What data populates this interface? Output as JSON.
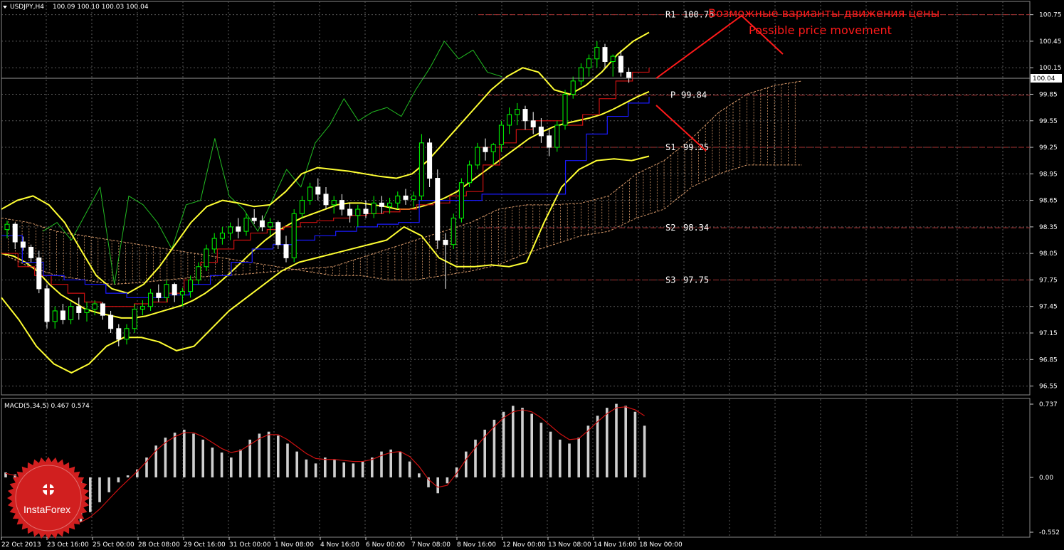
{
  "header": {
    "symbol": "USDJPY,H4",
    "ohlc": "100.09 100.10 100.03 100.04"
  },
  "macd": {
    "label": "MACD(5,34,5) 0.467 0.574"
  },
  "colors": {
    "bull": "#00ff00",
    "bear": "#ffffff",
    "bollinger": "#ffff33",
    "tenkan": "#cc1111",
    "kijun": "#1a1aff",
    "chikou": "#22bb22",
    "cloud": "#d89a6a",
    "pivot_line": "#aa3333",
    "annotation": "#ff1a1a",
    "grid": "#5a5a5a"
  },
  "chart_data": {
    "type": "candlestick",
    "symbol": "USDJPY",
    "timeframe": "H4",
    "current_price": "100.04",
    "ylim": [
      96.45,
      100.9
    ],
    "y_ticks": [
      "100.75",
      "100.45",
      "100.15",
      "99.85",
      "99.55",
      "99.25",
      "98.95",
      "98.65",
      "98.35",
      "98.05",
      "97.75",
      "97.45",
      "97.15",
      "96.85",
      "96.55"
    ],
    "x_ticks": [
      "22 Oct 2013",
      "23 Oct 16:00",
      "25 Oct 00:00",
      "28 Oct 08:00",
      "29 Oct 16:00",
      "31 Oct 00:00",
      "1 Nov 08:00",
      "4 Nov 16:00",
      "6 Nov 00:00",
      "7 Nov 08:00",
      "8 Nov 16:00",
      "12 Nov 00:00",
      "13 Nov 08:00",
      "14 Nov 16:00",
      "18 Nov 00:00"
    ],
    "pivots": [
      {
        "label": "R1",
        "value": 100.75
      },
      {
        "label": "P",
        "value": 99.84
      },
      {
        "label": "S1",
        "value": 99.25
      },
      {
        "label": "S2",
        "value": 98.34
      },
      {
        "label": "S3",
        "value": 97.75
      }
    ],
    "candles": [
      [
        98.32,
        98.42,
        98.22,
        98.38
      ],
      [
        98.38,
        98.4,
        98.1,
        98.18
      ],
      [
        98.18,
        98.24,
        98.08,
        98.12
      ],
      [
        98.12,
        98.15,
        97.95,
        98.0
      ],
      [
        98.0,
        98.08,
        97.6,
        97.65
      ],
      [
        97.65,
        97.7,
        97.2,
        97.28
      ],
      [
        97.28,
        97.45,
        97.2,
        97.4
      ],
      [
        97.4,
        97.48,
        97.25,
        97.3
      ],
      [
        97.3,
        97.5,
        97.25,
        97.45
      ],
      [
        97.45,
        97.55,
        97.3,
        97.38
      ],
      [
        97.38,
        97.5,
        97.28,
        97.42
      ],
      [
        97.42,
        97.52,
        97.35,
        97.48
      ],
      [
        97.48,
        97.5,
        97.3,
        97.35
      ],
      [
        97.35,
        97.4,
        97.15,
        97.2
      ],
      [
        97.2,
        97.25,
        97.0,
        97.08
      ],
      [
        97.08,
        97.25,
        97.02,
        97.2
      ],
      [
        97.2,
        97.48,
        97.15,
        97.42
      ],
      [
        97.42,
        97.52,
        97.35,
        97.45
      ],
      [
        97.45,
        97.65,
        97.4,
        97.6
      ],
      [
        97.6,
        97.7,
        97.5,
        97.55
      ],
      [
        97.55,
        97.75,
        97.5,
        97.7
      ],
      [
        97.7,
        97.72,
        97.5,
        97.58
      ],
      [
        97.58,
        97.66,
        97.45,
        97.62
      ],
      [
        97.62,
        97.8,
        97.55,
        97.75
      ],
      [
        97.75,
        97.95,
        97.7,
        97.9
      ],
      [
        97.9,
        98.15,
        97.85,
        98.1
      ],
      [
        98.1,
        98.28,
        98.05,
        98.22
      ],
      [
        98.22,
        98.35,
        98.15,
        98.28
      ],
      [
        98.28,
        98.4,
        98.2,
        98.35
      ],
      [
        98.35,
        98.45,
        98.22,
        98.3
      ],
      [
        98.3,
        98.5,
        98.25,
        98.45
      ],
      [
        98.45,
        98.55,
        98.38,
        98.42
      ],
      [
        98.42,
        98.48,
        98.3,
        98.35
      ],
      [
        98.35,
        98.45,
        98.25,
        98.4
      ],
      [
        98.4,
        98.42,
        98.1,
        98.15
      ],
      [
        98.15,
        98.25,
        97.95,
        98.0
      ],
      [
        98.0,
        98.55,
        97.95,
        98.5
      ],
      [
        98.5,
        98.7,
        98.45,
        98.65
      ],
      [
        98.65,
        98.85,
        98.6,
        98.8
      ],
      [
        98.8,
        98.9,
        98.65,
        98.72
      ],
      [
        98.72,
        98.8,
        98.55,
        98.6
      ],
      [
        98.6,
        98.7,
        98.5,
        98.65
      ],
      [
        98.65,
        98.72,
        98.48,
        98.55
      ],
      [
        98.55,
        98.62,
        98.4,
        98.48
      ],
      [
        98.48,
        98.6,
        98.35,
        98.55
      ],
      [
        98.55,
        98.65,
        98.45,
        98.5
      ],
      [
        98.5,
        98.7,
        98.45,
        98.62
      ],
      [
        98.62,
        98.7,
        98.5,
        98.58
      ],
      [
        98.58,
        98.68,
        98.5,
        98.62
      ],
      [
        98.62,
        98.75,
        98.55,
        98.7
      ],
      [
        98.7,
        98.78,
        98.6,
        98.66
      ],
      [
        98.66,
        98.75,
        98.58,
        98.7
      ],
      [
        98.7,
        99.4,
        98.65,
        99.3
      ],
      [
        99.3,
        99.35,
        98.8,
        98.9
      ],
      [
        98.9,
        99.0,
        98.1,
        98.2
      ],
      [
        98.2,
        98.28,
        97.65,
        98.15
      ],
      [
        98.15,
        98.5,
        98.1,
        98.45
      ],
      [
        98.45,
        98.9,
        98.4,
        98.85
      ],
      [
        98.85,
        99.1,
        98.8,
        99.05
      ],
      [
        99.05,
        99.3,
        99.0,
        99.25
      ],
      [
        99.25,
        99.35,
        99.1,
        99.2
      ],
      [
        99.2,
        99.3,
        99.05,
        99.28
      ],
      [
        99.28,
        99.55,
        99.2,
        99.5
      ],
      [
        99.5,
        99.7,
        99.4,
        99.62
      ],
      [
        99.62,
        99.75,
        99.5,
        99.68
      ],
      [
        99.68,
        99.72,
        99.45,
        99.55
      ],
      [
        99.55,
        99.65,
        99.4,
        99.48
      ],
      [
        99.48,
        99.58,
        99.3,
        99.38
      ],
      [
        99.38,
        99.45,
        99.15,
        99.25
      ],
      [
        99.25,
        99.55,
        99.2,
        99.5
      ],
      [
        99.5,
        99.9,
        99.45,
        99.85
      ],
      [
        99.85,
        100.05,
        99.8,
        100.0
      ],
      [
        100.0,
        100.2,
        99.95,
        100.15
      ],
      [
        100.15,
        100.3,
        100.05,
        100.25
      ],
      [
        100.25,
        100.45,
        100.15,
        100.38
      ],
      [
        100.38,
        100.42,
        100.15,
        100.22
      ],
      [
        100.22,
        100.3,
        100.05,
        100.28
      ],
      [
        100.28,
        100.35,
        100.05,
        100.1
      ],
      [
        100.1,
        100.15,
        99.98,
        100.04
      ]
    ],
    "bollinger_mid": [
      98.05,
      98.02,
      97.95,
      97.85,
      97.7,
      97.58,
      97.5,
      97.42,
      97.38,
      97.35,
      97.32,
      97.32,
      97.34,
      97.38,
      97.42,
      97.46,
      97.52,
      97.6,
      97.7,
      97.82,
      97.95,
      98.08,
      98.2,
      98.3,
      98.38,
      98.45,
      98.5,
      98.55,
      98.6,
      98.62,
      98.62,
      98.6,
      98.58,
      98.55,
      98.55,
      98.58,
      98.62,
      98.68,
      98.75,
      98.85,
      98.95,
      99.05,
      99.15,
      99.25,
      99.35,
      99.42,
      99.48,
      99.52,
      99.55,
      99.58,
      99.62,
      99.68,
      99.75,
      99.82,
      99.88
    ],
    "bollinger_upper": [
      98.55,
      98.65,
      98.7,
      98.6,
      98.4,
      98.1,
      97.8,
      97.65,
      97.6,
      97.7,
      97.9,
      98.15,
      98.4,
      98.58,
      98.65,
      98.62,
      98.58,
      98.6,
      98.75,
      98.95,
      99.02,
      99.0,
      98.98,
      98.95,
      98.92,
      98.9,
      98.95,
      99.1,
      99.3,
      99.5,
      99.7,
      99.9,
      100.05,
      100.15,
      100.1,
      99.9,
      99.85,
      99.95,
      100.1,
      100.3,
      100.45,
      100.55
    ],
    "bollinger_lower": [
      97.55,
      97.3,
      97.0,
      96.8,
      96.7,
      96.8,
      97.0,
      97.1,
      97.1,
      97.05,
      96.95,
      97.0,
      97.2,
      97.4,
      97.55,
      97.7,
      97.85,
      97.95,
      98.0,
      98.05,
      98.1,
      98.15,
      98.2,
      98.35,
      98.25,
      98.0,
      97.9,
      97.9,
      97.92,
      97.9,
      97.95,
      98.4,
      98.8,
      99.0,
      99.1,
      99.12,
      99.1,
      99.15
    ],
    "tenkan": [
      98.05,
      97.9,
      97.8,
      97.7,
      97.6,
      97.5,
      97.45,
      97.45,
      97.48,
      97.5,
      97.6,
      97.75,
      97.95,
      98.1,
      98.2,
      98.28,
      98.32,
      98.35,
      98.4,
      98.42,
      98.45,
      98.48,
      98.5,
      98.52,
      98.55,
      98.6,
      98.62,
      98.7,
      98.75,
      99.05,
      99.3,
      99.45,
      99.55,
      99.55,
      99.5,
      99.62,
      99.8,
      100.0,
      100.1,
      100.15
    ],
    "kijun": [
      98.25,
      97.95,
      97.8,
      97.75,
      97.7,
      97.6,
      97.55,
      97.55,
      97.58,
      97.7,
      97.8,
      97.95,
      98.1,
      98.15,
      98.2,
      98.25,
      98.3,
      98.35,
      98.38,
      98.4,
      98.65,
      98.65,
      98.65,
      98.72,
      98.72,
      98.72,
      98.72,
      99.1,
      99.4,
      99.6,
      99.75,
      99.82
    ],
    "chikou": [
      98.3,
      98.4,
      98.2,
      98.5,
      98.8,
      97.7,
      98.7,
      98.6,
      98.4,
      98.1,
      98.6,
      98.65,
      99.35,
      98.7,
      98.55,
      98.3,
      98.65,
      99.0,
      98.8,
      99.3,
      99.5,
      99.8,
      99.55,
      99.65,
      99.7,
      99.6,
      99.9,
      100.15,
      100.45,
      100.25,
      100.35,
      100.1,
      100.05
    ],
    "cloud_a": [
      98.05,
      97.9,
      97.8,
      97.75,
      97.7,
      97.72,
      97.75,
      97.78,
      97.8,
      97.82,
      97.85,
      97.88,
      97.9,
      98.0,
      98.1,
      98.2,
      98.3,
      98.4,
      98.55,
      98.6,
      98.6,
      98.62,
      98.7,
      98.95,
      99.1,
      99.35,
      99.65,
      99.85,
      99.95,
      100.0
    ],
    "cloud_b": [
      98.45,
      98.4,
      98.3,
      98.25,
      98.2,
      98.15,
      98.1,
      98.05,
      98.0,
      97.95,
      97.9,
      97.85,
      97.8,
      97.8,
      97.75,
      97.75,
      97.8,
      97.85,
      97.92,
      98.05,
      98.15,
      98.25,
      98.3,
      98.45,
      98.55,
      98.8,
      98.95,
      99.05,
      99.05,
      99.05
    ],
    "macd": {
      "label": "MACD(5,34,5)",
      "main_value": 0.467,
      "signal_value": 0.574,
      "ylim": [
        -0.552,
        0.737
      ],
      "y_ticks": [
        "0.737",
        "0.00",
        "-0.552"
      ],
      "hist": [
        0.05,
        0.03,
        -0.1,
        -0.2,
        -0.32,
        -0.42,
        -0.48,
        -0.5,
        -0.45,
        -0.35,
        -0.25,
        -0.15,
        -0.05,
        0.02,
        0.08,
        0.2,
        0.32,
        0.4,
        0.45,
        0.48,
        0.44,
        0.38,
        0.3,
        0.25,
        0.2,
        0.28,
        0.38,
        0.44,
        0.46,
        0.42,
        0.34,
        0.26,
        0.18,
        0.14,
        0.2,
        0.18,
        0.15,
        0.14,
        0.16,
        0.2,
        0.26,
        0.28,
        0.26,
        0.16,
        0.04,
        -0.1,
        -0.16,
        -0.06,
        0.1,
        0.26,
        0.38,
        0.48,
        0.58,
        0.66,
        0.72,
        0.7,
        0.64,
        0.55,
        0.46,
        0.38,
        0.34,
        0.4,
        0.52,
        0.62,
        0.7,
        0.74,
        0.72,
        0.66,
        0.52
      ],
      "signal": [
        0.04,
        0.02,
        -0.05,
        -0.14,
        -0.24,
        -0.34,
        -0.42,
        -0.46,
        -0.45,
        -0.4,
        -0.32,
        -0.22,
        -0.12,
        -0.03,
        0.06,
        0.16,
        0.27,
        0.35,
        0.41,
        0.45,
        0.45,
        0.41,
        0.35,
        0.29,
        0.25,
        0.27,
        0.33,
        0.39,
        0.43,
        0.43,
        0.38,
        0.31,
        0.24,
        0.19,
        0.18,
        0.18,
        0.17,
        0.16,
        0.16,
        0.18,
        0.22,
        0.25,
        0.26,
        0.21,
        0.11,
        -0.02,
        -0.1,
        -0.08,
        0.04,
        0.18,
        0.3,
        0.41,
        0.51,
        0.6,
        0.66,
        0.68,
        0.66,
        0.6,
        0.52,
        0.44,
        0.38,
        0.39,
        0.47,
        0.56,
        0.64,
        0.7,
        0.71,
        0.68,
        0.62
      ]
    }
  },
  "annotations": {
    "ru": "Возможные варианты движения цены",
    "en": "Possible price movement"
  },
  "logo": {
    "text": "InstaForex"
  }
}
